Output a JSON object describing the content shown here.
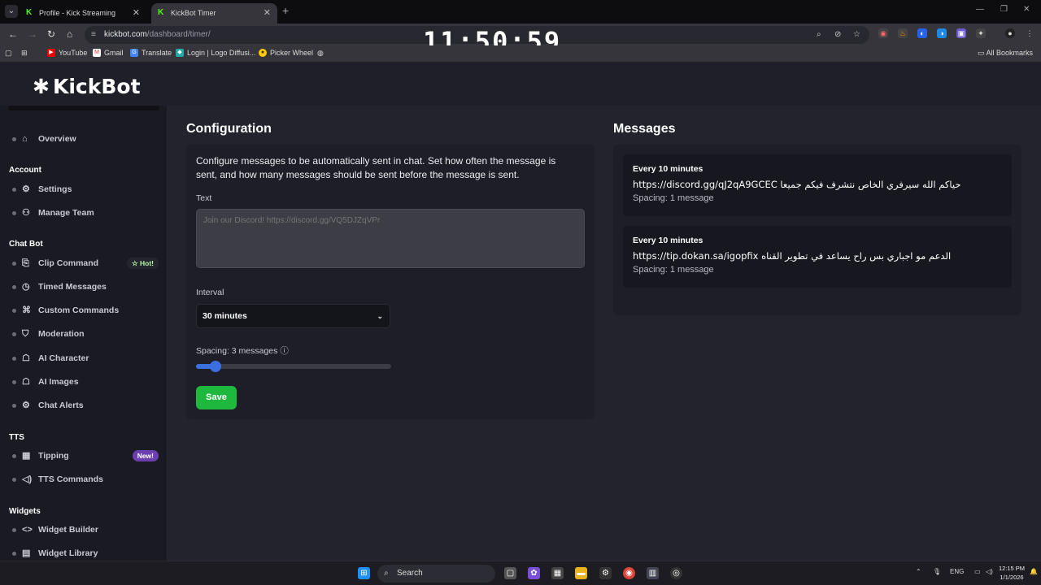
{
  "browser": {
    "tabs": [
      {
        "title": "Profile - Kick Streaming",
        "active": false
      },
      {
        "title": "KickBot Timer",
        "active": true
      }
    ],
    "url_host": "kickbot.com",
    "url_path": "/dashboard/timer/",
    "bookmarks": [
      "YouTube",
      "Gmail",
      "Translate",
      "Login | Logo Diffusi...",
      "Picker Wheel"
    ],
    "all_bookmarks": "All Bookmarks"
  },
  "overlay_clock": "11:50:59",
  "app": {
    "logo": "KickBot",
    "sidebar": {
      "items_top": [
        {
          "label": "Overview",
          "icon": "home-icon"
        }
      ],
      "sections": [
        {
          "title": "Account",
          "items": [
            {
              "label": "Settings",
              "icon": "gear-icon"
            },
            {
              "label": "Manage Team",
              "icon": "users-icon"
            }
          ]
        },
        {
          "title": "Chat Bot",
          "items": [
            {
              "label": "Clip Command",
              "icon": "clip-icon",
              "badge": "Hot!"
            },
            {
              "label": "Timed Messages",
              "icon": "clock-icon"
            },
            {
              "label": "Custom Commands",
              "icon": "commands-icon"
            },
            {
              "label": "Moderation",
              "icon": "shield-icon"
            },
            {
              "label": "AI Character",
              "icon": "robot-icon"
            },
            {
              "label": "AI Images",
              "icon": "image-icon"
            },
            {
              "label": "Chat Alerts",
              "icon": "bell-icon"
            }
          ]
        },
        {
          "title": "TTS",
          "items": [
            {
              "label": "Tipping",
              "icon": "store-icon",
              "badge": "New!"
            },
            {
              "label": "TTS Commands",
              "icon": "speaker-icon"
            }
          ]
        },
        {
          "title": "Widgets",
          "items": [
            {
              "label": "Widget Builder",
              "icon": "code-icon"
            },
            {
              "label": "Widget Library",
              "icon": "library-icon"
            }
          ]
        }
      ]
    },
    "configuration": {
      "heading": "Configuration",
      "description": "Configure messages to be automatically sent in chat. Set how often the message is sent, and how many messages should be sent before the message is sent.",
      "text_label": "Text",
      "text_placeholder": "Join our Discord! https://discord.gg/VQ5DJZqVPr",
      "interval_label": "Interval",
      "interval_value": "30 minutes",
      "spacing_label": "Spacing: 3 messages",
      "spacing_fraction": 0.1,
      "save_label": "Save"
    },
    "messages": {
      "heading": "Messages",
      "items": [
        {
          "interval": "Every 10 minutes",
          "text": "https://discord.gg/qJ2qA9GCEC حياكم الله سيرفري الخاص نتشرف فيكم جميعا",
          "spacing": "Spacing: 1 message"
        },
        {
          "interval": "Every 10 minutes",
          "text": "https://tip.dokan.sa/igopfix الدعم مو اجباري بس راح يساعد في تطوير القناه",
          "spacing": "Spacing: 1 message"
        }
      ]
    }
  },
  "taskbar": {
    "search_placeholder": "Search",
    "language": "ENG",
    "time": "12:15 PM",
    "date": "1/1/2026"
  },
  "colors": {
    "accent": "#3b6fe0",
    "save": "#1eb83e",
    "kick_green": "#53fc18"
  }
}
